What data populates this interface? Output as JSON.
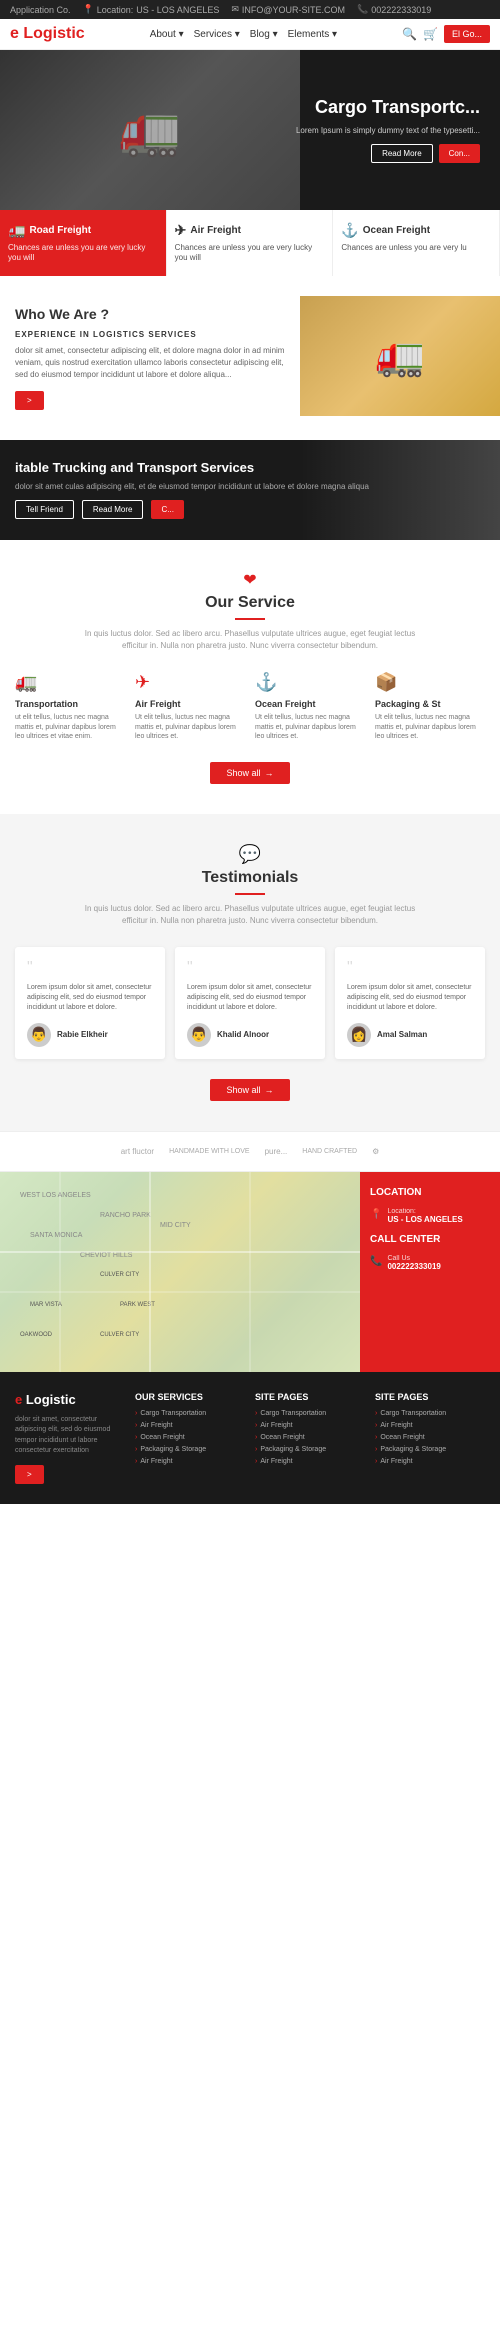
{
  "topBar": {
    "appLabel": "Application Co.",
    "location": {
      "label": "Location:",
      "value": "US - LOS ANGELES"
    },
    "email": {
      "label": "Email:",
      "value": "INFO@YOUR-SITE.COM"
    },
    "phone": {
      "label": "Call Us:",
      "value": "002222333019"
    }
  },
  "header": {
    "logo": "e Logistic",
    "nav": [
      {
        "label": "About"
      },
      {
        "label": "Services"
      },
      {
        "label": "Blog"
      },
      {
        "label": "Elements"
      }
    ],
    "ctaButton": "El Go..."
  },
  "hero": {
    "title": "Cargo Transportc...",
    "subtitle": "Lorem Ipsum is simply dummy text of the typesetti...",
    "btn1": "Read More",
    "btn2": "Con..."
  },
  "serviceBoxes": [
    {
      "icon": "🚛",
      "title": "Road Freight",
      "text": "Chances are unless you are very lucky you will"
    },
    {
      "icon": "✈",
      "title": "Air Freight",
      "text": "Chances are unless you are very lucky you will"
    },
    {
      "icon": "⚓",
      "title": "Ocean Freight",
      "text": "Chances are unless you are very lu"
    }
  ],
  "whoWeAre": {
    "subtitle": "",
    "title": "Who We Are ?",
    "experienceLabel": "experience in Logistics services",
    "text": "dolor sit amet, consectetur adipiscing elit, et dolore magna dolor in ad minim veniam, quis nostrud exercitation ullamco laboris consectetur adipiscing elit, sed do eiusmod tempor incididunt ut labore et dolore aliqua...",
    "btnLabel": ">"
  },
  "trucking": {
    "title": "itable Trucking and Transport Services",
    "text": "dolor sit amet culas adipiscing elit, et de eiusmod tempor incididunt ut labore et dolore magna aliqua",
    "btn1": "Tell Friend",
    "btn2": "Read More",
    "btn3": "C..."
  },
  "ourService": {
    "icon": "❤",
    "title": "Our Service",
    "subtitle": "In quis luctus dolor. Sed ac libero arcu. Phasellus vulputate ultrices augue, eget feugiat lectus efficitur in. Nulla non pharetra justo. Nunc viverra consectetur bibendum.",
    "services": [
      {
        "icon": "🚛",
        "title": "Transportation",
        "text": "ut elit tellus, luctus nec magna mattis et, pulvinar dapibus lorem leo ultrices et vitae enim."
      },
      {
        "icon": "✈",
        "title": "Air Freight",
        "text": "Ut elit tellus, luctus nec magna mattis et, pulvinar dapibus lorem leo ultrices et."
      },
      {
        "icon": "⚓",
        "title": "Ocean Freight",
        "text": "Ut elit tellus, luctus nec magna mattis et, pulvinar dapibus lorem leo ultrices et."
      },
      {
        "icon": "📦",
        "title": "Packaging & St",
        "text": "Ut elit tellus, luctus nec magna mattis et, pulvinar dapibus lorem leo ultrices et."
      }
    ],
    "showAll": "Show all"
  },
  "testimonials": {
    "icon": "💬",
    "title": "Testimonials",
    "subtitle": "In quis luctus dolor. Sed ac libero arcu. Phasellus vulputate ultrices augue, eget feugiat lectus efficitur in. Nulla non pharetra justo. Nunc viverra consectetur bibendum.",
    "items": [
      {
        "text": "Lorem ipsum dolor sit amet, consectetur adipiscing elit, sed do eiusmod tempor incididunt ut labore et dolore.",
        "author": "Rabie Elkheir",
        "avatar": "👨"
      },
      {
        "text": "Lorem ipsum dolor sit amet, consectetur adipiscing elit, sed do eiusmod tempor incididunt ut labore et dolore.",
        "author": "Khalid Alnoor",
        "avatar": "👨"
      },
      {
        "text": "Lorem ipsum dolor sit amet, consectetur adipiscing elit, sed do eiusmod tempor incididunt ut labore et dolore.",
        "author": "Amal Salman",
        "avatar": "👩"
      }
    ],
    "showAll": "Show all"
  },
  "brands": [
    {
      "name": "Brand 1",
      "text": "art fluctor"
    },
    {
      "name": "Brand 2",
      "text": "HANDMADE WITH LOVE"
    },
    {
      "name": "Brand 3",
      "text": "pure..."
    },
    {
      "name": "Brand 4",
      "text": "HAND CRAFTED"
    },
    {
      "name": "Brand 5",
      "text": "⚙"
    }
  ],
  "map": {
    "location": {
      "label": "LOCATION",
      "sublabel": "Location:",
      "value": "US - LOS ANGELES"
    },
    "callCenter": {
      "label": "CALL CENTER",
      "sublabel": "Call Us",
      "value": "002222333019"
    }
  },
  "footer": {
    "logo": "e Logistic",
    "text": "dolor sit amet, consectetur adipiscing elit, sed do eiusmod tempor incididunt ut labore consectetur exercitation",
    "btnLabel": ">",
    "cols": [
      {
        "title": "OUR SERVICES",
        "links": [
          "Cargo Transportation",
          "Air Freight",
          "Ocean Freight",
          "Packaging & Storage",
          "Air Freight"
        ]
      },
      {
        "title": "SITE PAGES",
        "links": [
          "Cargo Transportation",
          "Air Freight",
          "Ocean Freight",
          "Packaging & Storage",
          "Air Freight"
        ]
      },
      {
        "title": "SITE PAGES",
        "links": [
          "Cargo Transportation",
          "Air Freight",
          "Ocean Freight",
          "Packaging & Storage",
          "Air Freight"
        ]
      }
    ]
  }
}
